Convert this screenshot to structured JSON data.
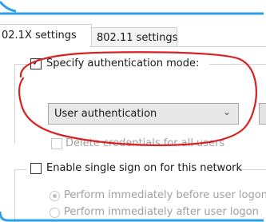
{
  "tabs": [
    {
      "label": "02.1X settings",
      "active": true
    },
    {
      "label": "802.11 settings",
      "active": false
    }
  ],
  "authentication": {
    "specify_label": "Specify authentication mode:",
    "specify_checked": true,
    "mode_value": "User authentication",
    "delete_credentials_label": "Delete credentials for all users",
    "delete_credentials_checked": false,
    "delete_credentials_enabled": false
  },
  "sso": {
    "enable_label": "Enable single sign on for this network",
    "enable_checked": false,
    "options": [
      {
        "label": "Perform immediately before user logon",
        "selected": true,
        "enabled": false
      },
      {
        "label": "Perform immediately after user logon",
        "selected": false,
        "enabled": false
      }
    ]
  },
  "colors": {
    "frame_blue": "#2b9fe8",
    "annotation_red": "#d92020"
  },
  "annotations": [
    {
      "type": "hand-drawn-ellipse",
      "target": "authentication-mode-group"
    }
  ]
}
